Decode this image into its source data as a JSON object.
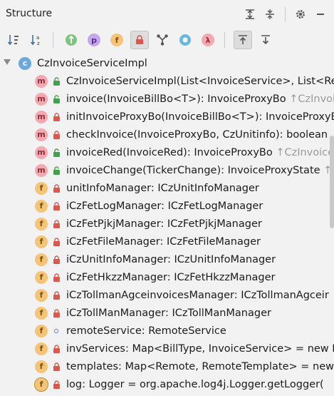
{
  "panel": {
    "title": "Structure"
  },
  "tree": {
    "root": {
      "kind": "c",
      "label": "CzInvoiceServiceImpl"
    },
    "items": [
      {
        "kind": "m",
        "vis": "public",
        "label": "CzInvoiceServiceImpl(List<InvoiceService>, List<Re",
        "tail": ""
      },
      {
        "kind": "m",
        "vis": "public",
        "label": "invoice(InvoiceBillBo<T>): InvoiceProxyBo ",
        "tail": "↑CzInvoic"
      },
      {
        "kind": "m",
        "vis": "private",
        "label": "initInvoiceProxyBo(InvoiceBillBo<T>): InvoiceProxyB",
        "tail": ""
      },
      {
        "kind": "m",
        "vis": "private",
        "label": "checkInvoice(InvoiceProxyBo, CzUnitinfo): boolean",
        "tail": ""
      },
      {
        "kind": "m",
        "vis": "public",
        "label": "invoiceRed(InvoiceRed): InvoiceProxyBo ",
        "tail": "↑CzInvoice"
      },
      {
        "kind": "m",
        "vis": "public",
        "label": "invoiceChange(TickerChange): InvoiceProxyState ",
        "tail": "↑C"
      },
      {
        "kind": "f",
        "vis": "private",
        "label": "unitInfoManager: ICzUnitInfoManager",
        "tail": ""
      },
      {
        "kind": "f",
        "vis": "private",
        "label": "iCzFetLogManager: ICzFetLogManager",
        "tail": ""
      },
      {
        "kind": "f",
        "vis": "private",
        "label": "iCzFetPjkjManager: ICzFetPjkjManager",
        "tail": ""
      },
      {
        "kind": "f",
        "vis": "private",
        "label": "iCzFetFileManager: ICzFetFileManager",
        "tail": ""
      },
      {
        "kind": "f",
        "vis": "private",
        "label": "iCzUnitInfoManager: ICzUnitInfoManager",
        "tail": ""
      },
      {
        "kind": "f",
        "vis": "private",
        "label": "iCzFetHkzzManager: ICzFetHkzzManager",
        "tail": ""
      },
      {
        "kind": "f",
        "vis": "private",
        "label": "iCzTollmanAgceinvoicesManager: ICzTollmanAgceir",
        "tail": ""
      },
      {
        "kind": "f",
        "vis": "private",
        "label": "iCzTollManManager: ICzTollManManager",
        "tail": ""
      },
      {
        "kind": "f",
        "vis": "package",
        "label": "remoteService: RemoteService",
        "tail": ""
      },
      {
        "kind": "f",
        "vis": "private",
        "label": "invServices: Map<BillType, InvoiceService> = new H",
        "tail": ""
      },
      {
        "kind": "f",
        "vis": "private",
        "label": "templates: Map<Remote, RemoteTemplate> = new",
        "tail": ""
      },
      {
        "kind": "f-static",
        "vis": "private",
        "label": "log: Logger = org.apache.log4j.Logger.getLogger(",
        "tail": ""
      }
    ]
  },
  "colors": {
    "method": "#f4a9b0",
    "field": "#f5c476",
    "class": "#6aa8de",
    "private_lock": "#e0564a",
    "public_lock": "#3fa34a"
  }
}
